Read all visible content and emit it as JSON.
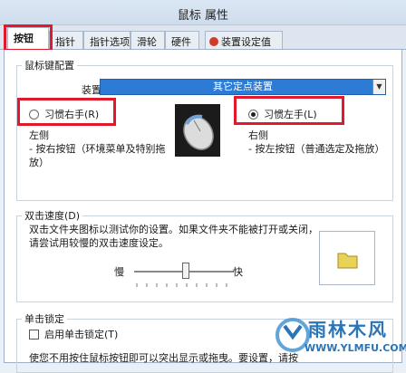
{
  "window": {
    "title": "鼠标 属性"
  },
  "tabs": [
    {
      "label": "按钮",
      "active": true
    },
    {
      "label": "指针"
    },
    {
      "label": "指针选项"
    },
    {
      "label": "滑轮"
    },
    {
      "label": "硬件"
    },
    {
      "label": "装置设定值",
      "icon": "device-settings-icon"
    }
  ],
  "button_config": {
    "legend": "鼠标键配置",
    "device_label": "装置：(V)",
    "device_value": "其它定点装置",
    "right_hand_label": "习惯右手(R)",
    "left_hand_label": "习惯左手(L)",
    "left_title": "左侧",
    "left_desc": "- 按右按钮（环境菜单及特别拖放）",
    "right_title": "右侧",
    "right_desc": "- 按左按钮（普通选定及拖放）",
    "selected": "left"
  },
  "double_click": {
    "legend": "双击速度(D)",
    "desc": "双击文件夹图标以测试你的设置。如果文件夹不能被打开或关闭，请尝试用较慢的双击速度设定。",
    "slow_label": "慢",
    "fast_label": "快"
  },
  "click_lock": {
    "legend": "单击锁定",
    "checkbox_label": "启用单击锁定(T)",
    "desc": "使您不用按住鼠标按钮即可以突出显示或拖曳。要设置，请按"
  },
  "watermark": {
    "brand": "雨林木风",
    "url": "WWW.YLMFU.COM"
  },
  "colors": {
    "highlight": "#e2182b",
    "selection": "#2e7bd6"
  }
}
